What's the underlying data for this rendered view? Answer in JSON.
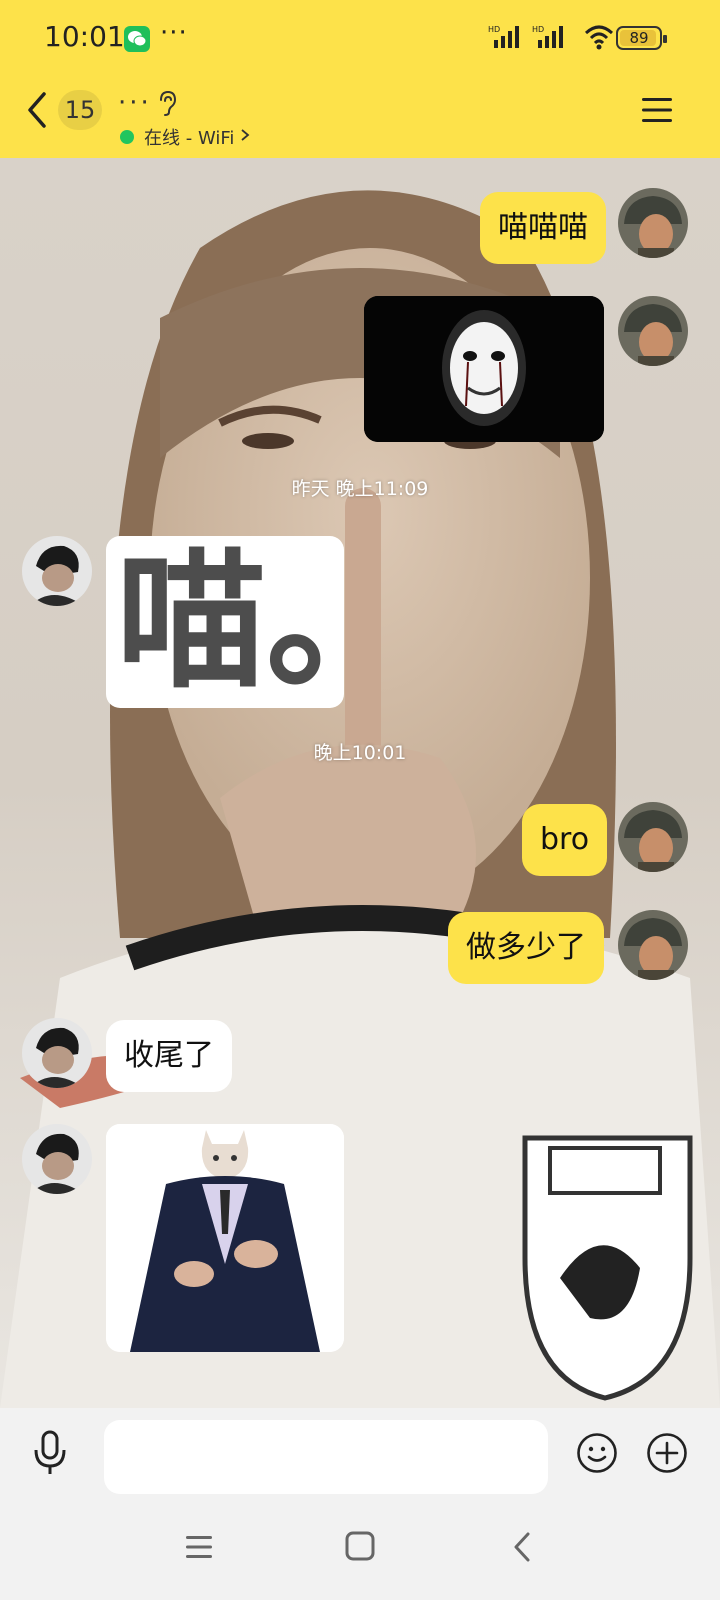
{
  "status_bar": {
    "time": "10:01",
    "more": "···",
    "battery": "89"
  },
  "header": {
    "unread_count": "15",
    "chat_name": "···",
    "status_text": "在线 - WiFi"
  },
  "messages": [
    {
      "type": "text",
      "sender": "self",
      "text": "喵喵喵"
    },
    {
      "type": "image",
      "sender": "self",
      "image": "masked-face-sticker"
    },
    {
      "type": "timestamp",
      "text": "昨天 晚上11:09"
    },
    {
      "type": "image",
      "sender": "other",
      "text": "喵。"
    },
    {
      "type": "timestamp",
      "text": "晚上10:01"
    },
    {
      "type": "text",
      "sender": "self",
      "text": "bro"
    },
    {
      "type": "text",
      "sender": "self",
      "text": "做多少了"
    },
    {
      "type": "text",
      "sender": "other",
      "text": "收尾了"
    },
    {
      "type": "image",
      "sender": "other",
      "image": "cat-in-suit-sticker"
    }
  ],
  "input": {
    "value": "",
    "placeholder": ""
  },
  "icons": {
    "back": "chevron-left-icon",
    "ear": "ear-icon",
    "menu": "hamburger-menu-icon",
    "mic": "microphone-icon",
    "emoji": "smiley-icon",
    "plus": "plus-icon"
  },
  "colors": {
    "accent": "#fde24a",
    "online": "#22c55e",
    "other_bubble": "#ffffff"
  }
}
